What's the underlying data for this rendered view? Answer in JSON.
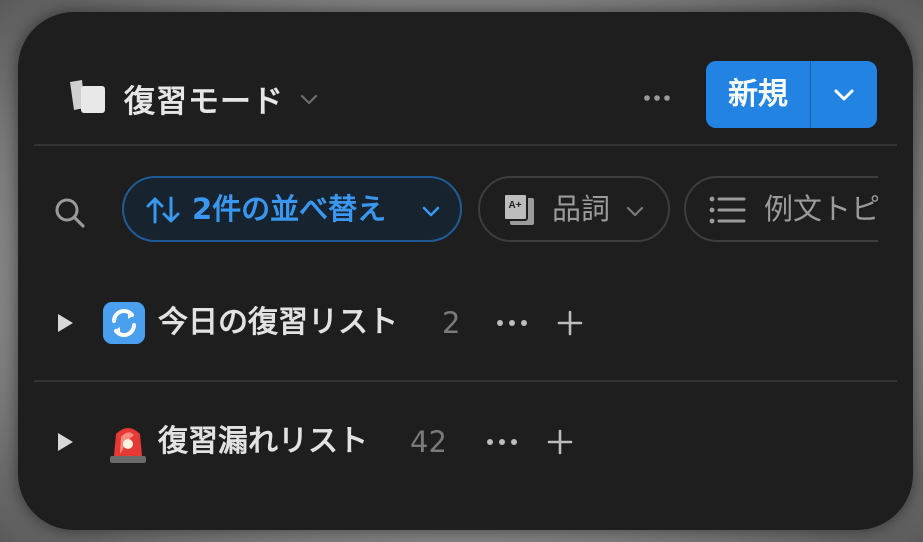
{
  "header": {
    "title": "復習モード",
    "new_button_label": "新規"
  },
  "filters": [
    {
      "label": "2件の並べ替え",
      "icon": "sort-arrows-icon",
      "active": true
    },
    {
      "label": "品詞",
      "icon": "select-property-icon",
      "active": false
    },
    {
      "label": "例文トピ",
      "icon": "list-icon",
      "active": false
    }
  ],
  "groups": [
    {
      "emoji": "repeat-arrows-icon",
      "label": "今日の復習リスト",
      "count": "2"
    },
    {
      "emoji": "siren-light-icon",
      "label": "復習漏れリスト",
      "count": "42"
    }
  ],
  "colors": {
    "background": "#1e1e1e",
    "accent": "#2383e2",
    "active_chip_text": "#3a97f0"
  }
}
